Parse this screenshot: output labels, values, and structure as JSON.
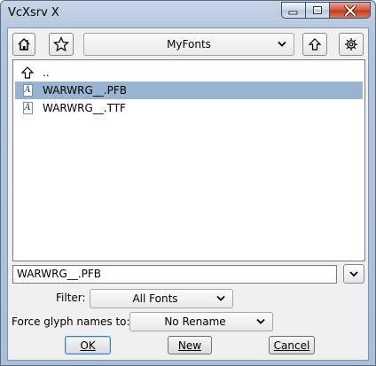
{
  "window": {
    "title": "VcXsrv X",
    "minimize_icon": "minimize-icon",
    "maximize_icon": "maximize-icon",
    "close_icon": "close-icon"
  },
  "toolbar": {
    "home_icon": "home-icon",
    "bookmark_icon": "star-icon",
    "location": "MyFonts",
    "up_icon": "arrow-up-icon",
    "settings_icon": "gear-icon"
  },
  "files": [
    {
      "name": "..",
      "icon": "arrow-up-icon",
      "selected": false
    },
    {
      "name": "WARWRG__.PFB",
      "icon": "font-file-icon",
      "selected": true
    },
    {
      "name": "WARWRG__.TTF",
      "icon": "font-file-icon",
      "selected": false
    }
  ],
  "filename": {
    "value": "WARWRG__.PFB"
  },
  "filter": {
    "label": "Filter:",
    "value": "All Fonts"
  },
  "glyph_names": {
    "label": "Force glyph names to:",
    "value": "No Rename"
  },
  "buttons": {
    "ok": "OK",
    "new": "New",
    "cancel": "Cancel"
  },
  "colors": {
    "selection": "#99b4d1",
    "close_button": "#c9452a",
    "title_bar": "#b9cbe0"
  }
}
